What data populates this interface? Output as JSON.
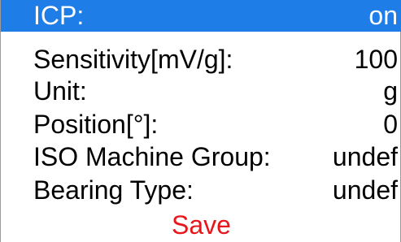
{
  "settings": {
    "items": [
      {
        "label": "ICP:",
        "value": "on",
        "selected": true
      },
      {
        "label": "Sensitivity[mV/g]:",
        "value": "100",
        "selected": false
      },
      {
        "label": "Unit:",
        "value": "g",
        "selected": false
      },
      {
        "label": "Position[°]:",
        "value": "0",
        "selected": false
      },
      {
        "label": "ISO Machine Group:",
        "value": "undef",
        "selected": false
      },
      {
        "label": "Bearing Type:",
        "value": "undef",
        "selected": false
      }
    ],
    "save_label": "Save"
  },
  "colors": {
    "selection_bg": "#1f7de8",
    "selection_text": "#ffffff",
    "text": "#000000",
    "save_text": "#e8161a"
  }
}
